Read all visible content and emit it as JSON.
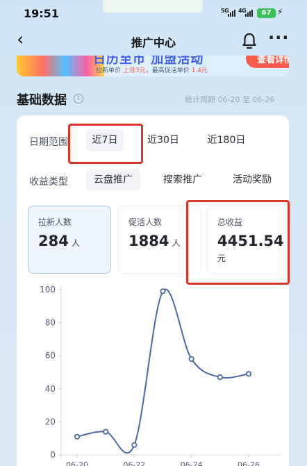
{
  "status_bar": {
    "time": "19:51",
    "signal_1": "5G",
    "signal_2": "4G",
    "battery": "67"
  },
  "nav": {
    "back_icon": "chevron-left-icon",
    "title": "推广中心",
    "bell_icon": "bell-icon",
    "more_label": "···"
  },
  "banner": {
    "headline": "日历至币 加盟活动",
    "sub_prefix": "拉新单价 ",
    "sub_hl1": "上涨3元",
    "sub_mid": "，最高促活单价 ",
    "sub_hl2": "1.4元",
    "button": "查看详情"
  },
  "section": {
    "title": "基础数据",
    "info_icon": "info-icon",
    "period": "统计周期 06-20 至 06-26"
  },
  "filters": {
    "date_label": "日期范围",
    "date_options": [
      "近7日",
      "近30日",
      "近180日"
    ],
    "type_label": "收益类型",
    "type_options": [
      "云盘推广",
      "搜索推广",
      "活动奖励"
    ]
  },
  "stats": [
    {
      "label": "拉新人数",
      "value": "284",
      "unit": "人"
    },
    {
      "label": "促活人数",
      "value": "1884",
      "unit": "人"
    },
    {
      "label": "总收益",
      "value": "4451.54",
      "unit": "元"
    }
  ],
  "colors": {
    "accent": "#4a67a8",
    "highlight_box": "#d8362b"
  },
  "chart_data": {
    "type": "line",
    "x": [
      "06-20",
      "06-21",
      "06-22",
      "06-23",
      "06-24",
      "06-25",
      "06-26"
    ],
    "x_tick_labels": [
      "06-20",
      "06-22",
      "06-24",
      "06-26"
    ],
    "series": [
      {
        "values": [
          11,
          14,
          6,
          99,
          58,
          47,
          49
        ]
      }
    ],
    "ylim": [
      0,
      100
    ],
    "y_ticks": [
      "0",
      "20",
      "40",
      "60",
      "80",
      "100"
    ],
    "grid": false,
    "smooth": true
  }
}
